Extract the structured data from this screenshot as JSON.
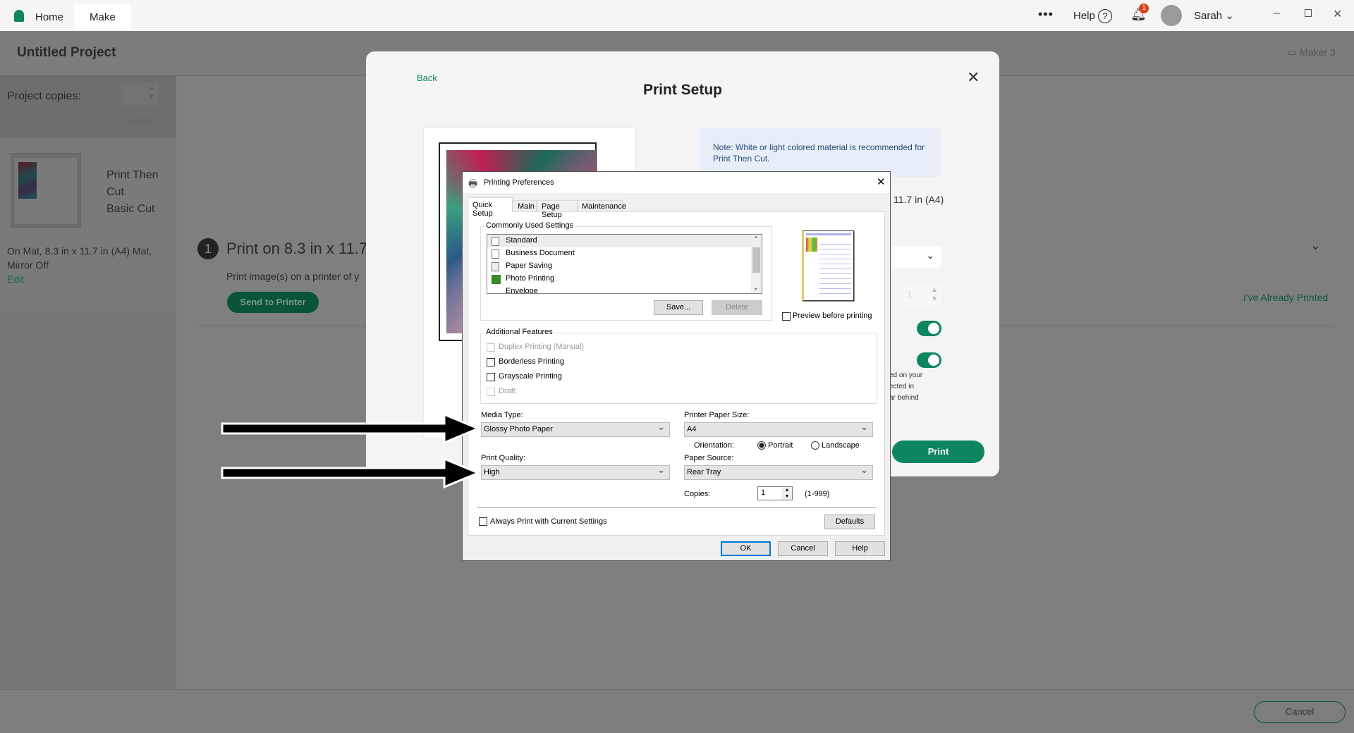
{
  "topbar": {
    "home": "Home",
    "make": "Make",
    "help": "Help",
    "notifications": "1",
    "user": "Sarah"
  },
  "project": {
    "title": "Untitled Project",
    "machine": "Maker 3",
    "copies_label": "Project copies:",
    "copies_value": "1",
    "apply": "Apply",
    "mat_lines": [
      "Print Then",
      "Cut",
      "Basic Cut"
    ],
    "mat_info_1": "On Mat, 8.3 in x 11.7 in (A4) Mat,",
    "mat_info_2": "Mirror Off",
    "edit": "Edit"
  },
  "step": {
    "number": "1",
    "title": "Print on 8.3 in x 11.7",
    "subtitle": "Print image(s) on a printer of y",
    "send": "Send to Printer",
    "already": "I've Already Printed"
  },
  "print_setup": {
    "back": "Back",
    "title": "Print Setup",
    "note": "Note: White or light colored material is recommended for Print Then Cut.",
    "size": "11.7 in (A4)",
    "copies": "1",
    "toggle1_on": true,
    "toggle2_on": true,
    "partial_lines": [
      "ed on your",
      "ected in",
      "ar behind"
    ],
    "print": "Print"
  },
  "prefs": {
    "title": "Printing Preferences",
    "tabs": [
      "Quick Setup",
      "Main",
      "Page Setup",
      "Maintenance"
    ],
    "commonly_used": "Commonly Used Settings",
    "settings": [
      "Standard",
      "Business Document",
      "Paper Saving",
      "Photo Printing",
      "Envelope"
    ],
    "save": "Save...",
    "delete": "Delete",
    "preview": "Preview before printing",
    "additional": "Additional Features",
    "features": [
      "Duplex Printing (Manual)",
      "Borderless Printing",
      "Grayscale Printing",
      "Draft"
    ],
    "media_label": "Media Type:",
    "media": "Glossy Photo Paper",
    "paper_size_label": "Printer Paper Size:",
    "paper_size": "A4",
    "orientation": "Orientation:",
    "portrait": "Portrait",
    "landscape": "Landscape",
    "quality_label": "Print Quality:",
    "quality": "High",
    "source_label": "Paper Source:",
    "source": "Rear Tray",
    "copies_label": "Copies:",
    "copies": "1",
    "copies_range": "(1-999)",
    "always": "Always Print with Current Settings",
    "defaults": "Defaults",
    "ok": "OK",
    "cancel": "Cancel",
    "help": "Help"
  },
  "footer": {
    "cancel": "Cancel"
  }
}
